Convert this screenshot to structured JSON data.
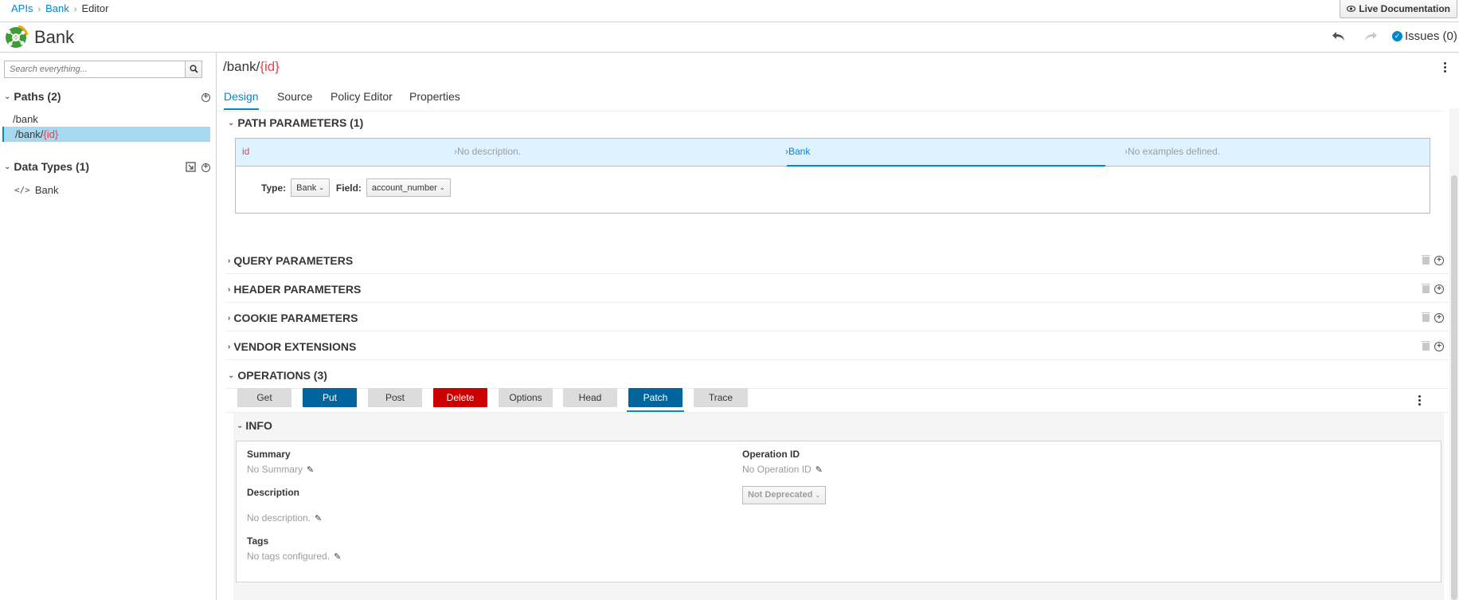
{
  "breadcrumb": {
    "items": [
      "APIs",
      "Bank"
    ],
    "current": "Editor"
  },
  "live_documentation": "Live Documentation",
  "header": {
    "title": "Bank",
    "issues": "Issues (0)"
  },
  "sidebar": {
    "search_placeholder": "Search everything...",
    "paths_heading": "Paths (2)",
    "paths": [
      {
        "base": "/bank",
        "param": ""
      },
      {
        "base": "/bank/",
        "param": "{id}"
      }
    ],
    "datatypes_heading": "Data Types (1)",
    "datatypes": [
      "Bank"
    ]
  },
  "main": {
    "path_base": "/bank/",
    "path_param": "{id}",
    "tabs": [
      "Design",
      "Source",
      "Policy Editor",
      "Properties"
    ],
    "active_tab": "Design",
    "path_parameters": {
      "heading": "PATH PARAMETERS (1)",
      "name": "id",
      "description": "No description.",
      "type": "Bank",
      "examples": "No examples defined.",
      "type_label": "Type:",
      "type_value": "Bank",
      "field_label": "Field:",
      "field_value": "account_number"
    },
    "sections": [
      "QUERY PARAMETERS",
      "HEADER PARAMETERS",
      "COOKIE PARAMETERS",
      "VENDOR EXTENSIONS"
    ],
    "operations": {
      "heading": "OPERATIONS (3)",
      "buttons": [
        "Get",
        "Put",
        "Post",
        "Delete",
        "Options",
        "Head",
        "Patch",
        "Trace"
      ],
      "selected": "Patch",
      "info": {
        "heading": "INFO",
        "summary_label": "Summary",
        "summary_value": "No Summary",
        "operation_id_label": "Operation ID",
        "operation_id_value": "No Operation ID",
        "deprecated": "Not Deprecated",
        "description_label": "Description",
        "description_value": "No description.",
        "tags_label": "Tags",
        "tags_value": "No tags configured."
      }
    }
  },
  "colors": {
    "accent": "#0088ce",
    "selected_bg": "#a6d9ef",
    "put_patch": "#00659c",
    "delete": "#cc0000",
    "param": "#e8414f"
  }
}
